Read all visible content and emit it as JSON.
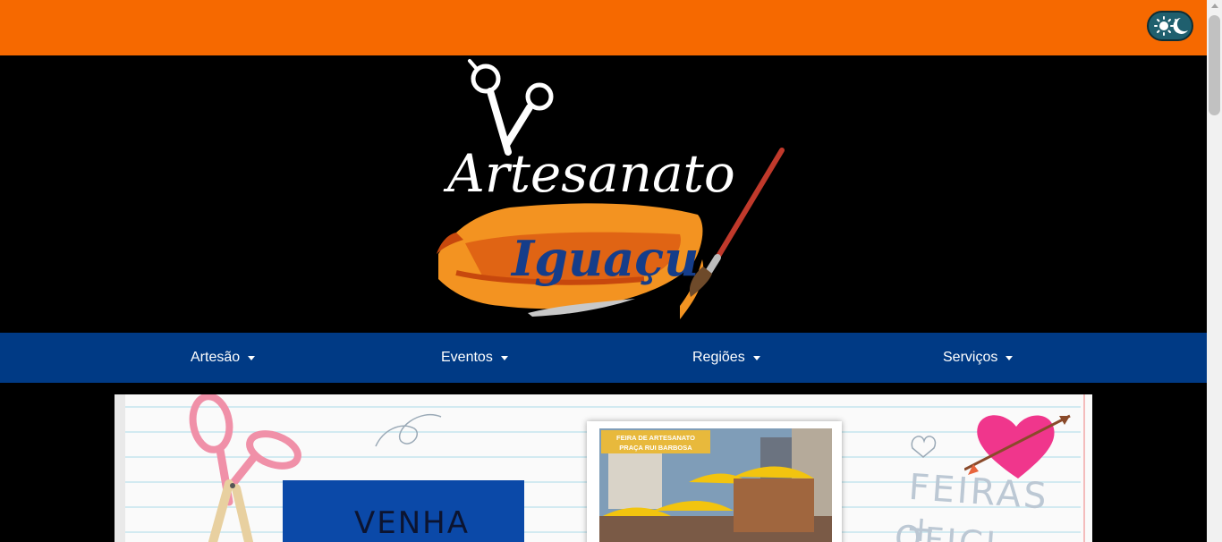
{
  "header": {
    "logo_line1": "Artesanato",
    "logo_line2": "Iguaçu"
  },
  "theme_toggle": {
    "icon": "sun-moon-icon"
  },
  "nav": {
    "items": [
      {
        "label": "Artesão"
      },
      {
        "label": "Eventos"
      },
      {
        "label": "Regiões"
      },
      {
        "label": "Serviços"
      }
    ]
  },
  "banner": {
    "promo_text": "VENHA",
    "photo_caption_line1": "FEIRA DE ARTESANATO",
    "photo_caption_line2": "PRAÇA RUI BARBOSA",
    "feiras_text": "FEIRAS +",
    "oficinas_text": "OFICI"
  },
  "colors": {
    "topbar": "#f66900",
    "nav": "#003a85",
    "accent_blue": "#0b49a8"
  }
}
